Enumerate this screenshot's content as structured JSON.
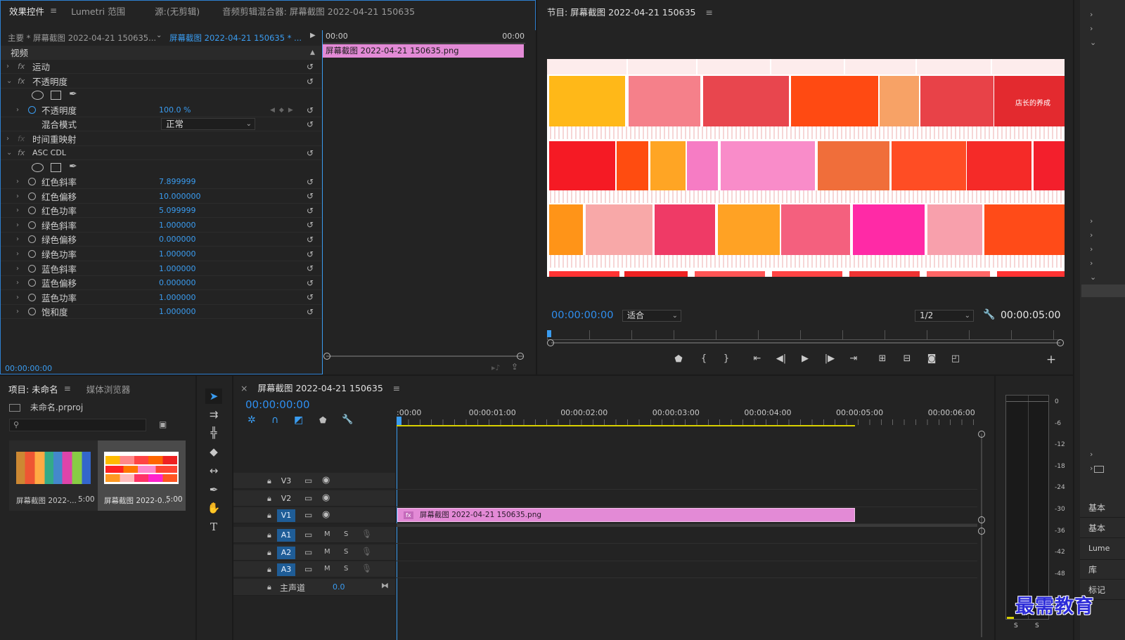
{
  "effect_controls": {
    "tabs": [
      "效果控件",
      "Lumetri 范围",
      "源:(无剪辑)",
      "音频剪辑混合器: 屏幕截图 2022-04-21 150635"
    ],
    "master_label": "主要 * 屏幕截图 2022-04-21 150635...",
    "clip_label": "屏幕截图 2022-04-21 150635 * ...",
    "time_start": "00:00",
    "time_end": "00:00",
    "clip_bar_label": "屏幕截图 2022-04-21  150635.png",
    "section_video": "视频",
    "effects": [
      {
        "name": "运动"
      },
      {
        "name": "不透明度"
      },
      {
        "name": "时间重映射"
      },
      {
        "name": "ASC CDL"
      }
    ],
    "opacity_label": "不透明度",
    "opacity_value": "100.0 %",
    "blend_label": "混合模式",
    "blend_value": "正常",
    "cdl_params": [
      {
        "label": "红色斜率",
        "value": "7.899999"
      },
      {
        "label": "红色偏移",
        "value": "10.000000"
      },
      {
        "label": "红色功率",
        "value": "5.099999"
      },
      {
        "label": "绿色斜率",
        "value": "1.000000"
      },
      {
        "label": "绿色偏移",
        "value": "0.000000"
      },
      {
        "label": "绿色功率",
        "value": "1.000000"
      },
      {
        "label": "蓝色斜率",
        "value": "1.000000"
      },
      {
        "label": "蓝色偏移",
        "value": "0.000000"
      },
      {
        "label": "蓝色功率",
        "value": "1.000000"
      },
      {
        "label": "饱和度",
        "value": "1.000000"
      }
    ],
    "footer_time": "00:00:00:00"
  },
  "program": {
    "title": "节目: 屏幕截图 2022-04-21 150635",
    "timecode": "00:00:00:00",
    "fit": "适合",
    "quality": "1/2",
    "duration": "00:00:05:00",
    "thumb_caption": "店长的养成"
  },
  "project": {
    "tabs": [
      "项目: 未命名",
      "媒体浏览器"
    ],
    "file": "未命名.prproj",
    "items": [
      {
        "name": "屏幕截图 2022-...",
        "dur": "5:00"
      },
      {
        "name": "屏幕截图 2022-0...",
        "dur": "5:00"
      }
    ]
  },
  "timeline": {
    "title": "屏幕截图 2022-04-21 150635",
    "timecode": "00:00:00:00",
    "ruler": [
      ":00:00",
      "00:00:01:00",
      "00:00:02:00",
      "00:00:03:00",
      "00:00:04:00",
      "00:00:05:00",
      "00:00:06:00"
    ],
    "video_tracks": [
      "V3",
      "V2",
      "V1"
    ],
    "audio_tracks": [
      "A1",
      "A2",
      "A3"
    ],
    "audio_btn_m": "M",
    "audio_btn_s": "S",
    "master_label": "主声道",
    "master_value": "0.0",
    "clip_label": "屏幕截图 2022-04-21  150635.png"
  },
  "meter": {
    "scale": [
      "0",
      "-6",
      "-12",
      "-18",
      "-24",
      "-30",
      "-36",
      "-42",
      "-48"
    ],
    "bottom": [
      "S",
      "S"
    ]
  },
  "right_sidebar": {
    "items": [
      "基本",
      "基本",
      "Lume",
      "库",
      "标记"
    ]
  },
  "watermark": "最需教育",
  "colors": {
    "accent_blue": "#2f8ff0",
    "clip_pink": "#e38ad6",
    "playhead": "#3a9cf0",
    "work_area": "#d8d000"
  }
}
